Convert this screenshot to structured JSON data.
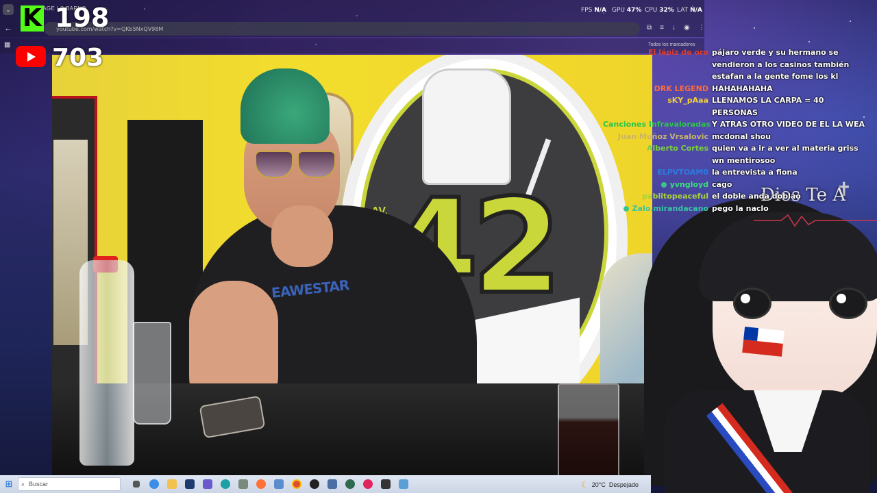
{
  "browser": {
    "tab_title": "STAGE | C BARNO",
    "url": "youtube.com/watch?v=QKb5NxQV98M",
    "bookmarks_label": "Todos los marcadores",
    "hud": {
      "fps_label": "FPS",
      "fps_value": "N/A",
      "gpu_label": "GPU",
      "gpu_value": "47%",
      "cpu_label": "CPU",
      "cpu_value": "32%",
      "lat_label": "LAT",
      "lat_value": "N/A"
    }
  },
  "overlay": {
    "kick_logo": "K",
    "kick_viewers": "198",
    "youtube_viewers": "703"
  },
  "chat": [
    {
      "name": "El lápiz de oro",
      "name_color": "#e23b2a",
      "badge": false,
      "message": "pájaro verde y su hermano se vendieron a los casinos también estafan a la gente fome los kl"
    },
    {
      "name": "DRK LEGEND",
      "name_color": "#ff6b3a",
      "badge": false,
      "message": "HAHAHAHAHA"
    },
    {
      "name": "sKY_pAaa",
      "name_color": "#f5d23a",
      "badge": false,
      "message": "LLENAMOS LA CARPA = 40 PERSONAS"
    },
    {
      "name": "Canciones Infravaloradas",
      "name_color": "#2ec44a",
      "badge": false,
      "message": "Y ATRAS OTRO VIDEO DE EL LA WEA"
    },
    {
      "name": "Juan Muñoz Vrsalovic",
      "name_color": "#c9b36a",
      "badge": false,
      "message": "mcdonal shou"
    },
    {
      "name": "Alberto Cortes",
      "name_color": "#7bd23a",
      "badge": false,
      "message": "quien va a ir a ver al materia griss wn mentirosoo"
    },
    {
      "name": "ELPVTOAM0",
      "name_color": "#2a7be0",
      "badge": false,
      "message": "la entrevista a fiona"
    },
    {
      "name": "yvngloyd",
      "name_color": "#3ae07b",
      "badge": true,
      "message": "cago"
    },
    {
      "name": "pablitopeaceful",
      "name_color": "#a7d23a",
      "badge": false,
      "message": "el doble anda doblao"
    },
    {
      "name": "Zalo.mirandacano",
      "name_color": "#3ac4a0",
      "badge": true,
      "message": "pego la naclo"
    }
  ],
  "video": {
    "sign_number": "42",
    "sign_av": "AV.",
    "shirt_text": "EAWESTAR"
  },
  "avatar": {
    "overlay_text": "Dios Te A"
  },
  "taskbar": {
    "search_placeholder": "Buscar",
    "weather_temp": "20°C",
    "weather_desc": "Despejado"
  }
}
